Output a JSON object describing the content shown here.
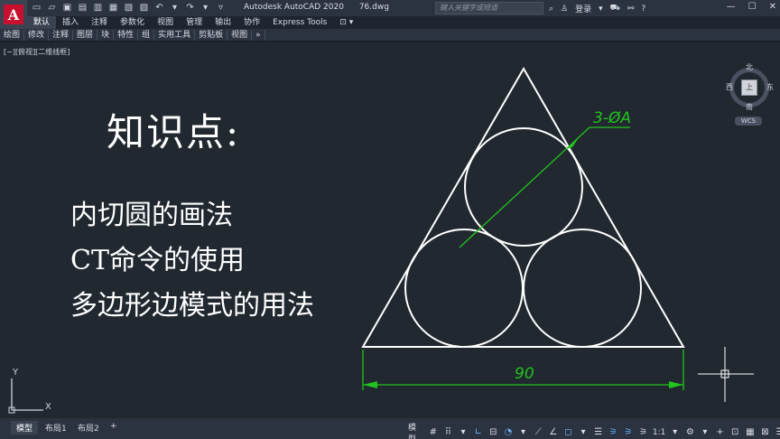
{
  "window": {
    "app_name": "Autodesk AutoCAD 2020",
    "file_name": "76.dwg",
    "search_placeholder": "键入关键字或短语",
    "login_label": "登录"
  },
  "ribbon_tabs": [
    "默认",
    "插入",
    "注释",
    "参数化",
    "视图",
    "管理",
    "输出",
    "协作",
    "Express Tools"
  ],
  "ribbon_panels": [
    "绘图",
    "修改",
    "注释",
    "图层",
    "块",
    "特性",
    "组",
    "实用工具",
    "剪贴板",
    "视图"
  ],
  "viewport_label": "[−][俯视][二维线框]",
  "lesson": {
    "title": "知识点:",
    "line1": "内切圆的画法",
    "line2": "CT命令的使用",
    "line3": "多边形边模式的用法"
  },
  "drawing": {
    "diameter_label": "3-ØA",
    "width_label": "90",
    "line_color": "#ffffff",
    "dim_color": "#22c41e"
  },
  "viewcube": {
    "north": "北",
    "south": "南",
    "west": "西",
    "east": "东",
    "face": "上",
    "wcs": "WCS"
  },
  "ucs": {
    "x": "X",
    "y": "Y"
  },
  "layout_tabs": [
    "模型",
    "布局1",
    "布局2",
    "+"
  ],
  "status": {
    "model_label": "模型",
    "scale": "1:1"
  }
}
